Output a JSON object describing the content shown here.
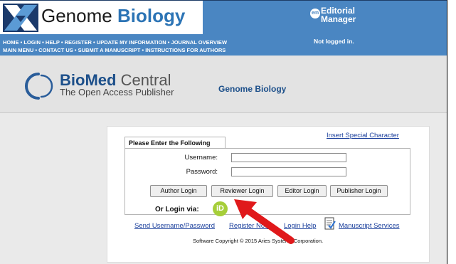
{
  "header": {
    "logo_word1": "Genome",
    "logo_word2": "Biology",
    "nav_row1": [
      "HOME",
      "LOGIN",
      "HELP",
      "REGISTER",
      "UPDATE MY INFORMATION",
      "JOURNAL OVERVIEW"
    ],
    "nav_row2": [
      "MAIN MENU",
      "CONTACT US",
      "SUBMIT A MANUSCRIPT",
      "INSTRUCTIONS FOR AUTHORS"
    ],
    "separator": "•",
    "em_badge": "em",
    "em_line1": "Editorial",
    "em_line2": "Manager",
    "status": "Not logged in."
  },
  "publisher": {
    "name_bold": "BioMed",
    "name_rest": " Central",
    "tagline": "The Open Access Publisher",
    "journal": "Genome Biology"
  },
  "login": {
    "tab_title": "Please Enter the Following",
    "special_char_link": "Insert Special Character",
    "username_label": "Username:",
    "password_label": "Password:",
    "username_value": "",
    "password_value": "",
    "buttons": {
      "author": "Author Login",
      "reviewer": "Reviewer Login",
      "editor": "Editor Login",
      "publisher": "Publisher Login"
    },
    "or_login_via": "Or Login via:",
    "orcid_label": "iD",
    "links": {
      "send_credentials": "Send Username/Password",
      "register": "Register Now",
      "help": "Login Help",
      "manuscript_services": "Manuscript Services"
    },
    "copyright": "Software Copyright © 2015 Aries Systems Corporation."
  },
  "colors": {
    "header_blue": "#4a86c2",
    "brand_blue": "#2c74b5",
    "link_blue": "#1a3f9c",
    "orcid_green": "#a6ce39",
    "annotation_red": "#e0191b"
  }
}
